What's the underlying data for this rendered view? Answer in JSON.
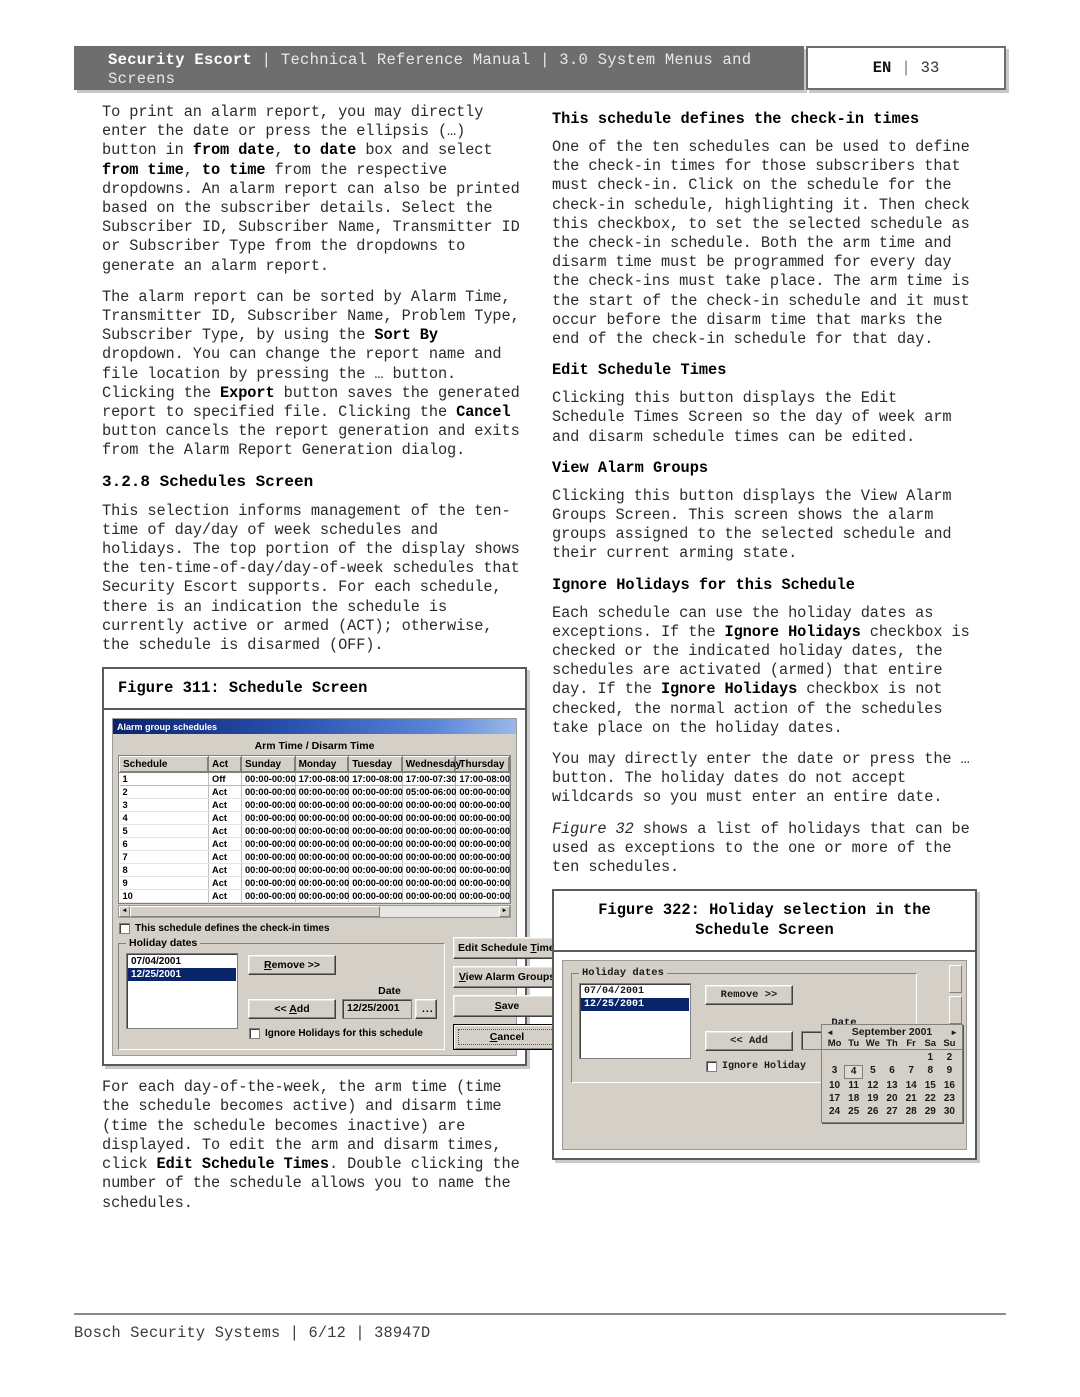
{
  "header": {
    "brand": "Security Escort",
    "sep": "|",
    "title_part1": "Technical Reference Manual",
    "title_part2": "3.0 System Menus and Screens",
    "full_title": "Security Escort | Technical Reference Manual | 3.0 System Menus and Screens",
    "language": "EN",
    "page_number": "33"
  },
  "left_column": {
    "p1_a": "To print an alarm report, you may directly enter the date or press the ellipsis (…) button in ",
    "p1_b1": "from date",
    "p1_c": ", ",
    "p1_b2": "to date",
    "p1_d": " box and select ",
    "p1_b3": "from time",
    "p1_e": ", ",
    "p1_b4": "to time",
    "p1_f": " from the respective dropdowns. An alarm report can also be printed based on the subscriber details. Select the Subscriber ID, Subscriber Name, Transmitter ID or Subscriber Type from the dropdowns to generate an alarm report.",
    "p2_a": "The alarm report can be sorted by Alarm Time, Transmitter ID, Subscriber Name, Problem Type, Subscriber Type, by using the ",
    "p2_b1": "Sort By",
    "p2_c": " dropdown. You can change the report name and file location by pressing the … button. Clicking the ",
    "p2_b2": "Export",
    "p2_d": " button saves the generated report to specified file. Clicking the ",
    "p2_b3": "Cancel",
    "p2_e": " button cancels the report generation and exits from the Alarm Report Generation dialog.",
    "section_heading": "3.2.8 Schedules Screen",
    "p3": "This selection informs management of the ten-time of day/day of week schedules and holidays. The top portion of the display shows the ten-time-of-day/day-of-week schedules that Security Escort supports. For each schedule, there is an indication the schedule is currently active or armed (ACT); otherwise, the schedule is disarmed (OFF).",
    "figure311_caption": "Figure 311: Schedule Screen",
    "p4_a": "For each day-of-the-week, the arm time (time the schedule becomes active) and disarm time (time the schedule becomes inactive) are displayed. To edit the arm and disarm times, click ",
    "p4_b1": "Edit Schedule Times",
    "p4_c": ". Double clicking the number of the schedule allows you to name the schedules."
  },
  "right_column": {
    "h1": "This schedule defines the check-in times",
    "p1": "One of the ten schedules can be used to define the check-in times for those subscribers that must check-in. Click on the schedule for the check-in schedule, highlighting it. Then check this checkbox, to set the selected schedule as the check-in schedule. Both the arm time and disarm time must be programmed for every day the check-ins must take place. The arm time is the start of the check-in schedule and it must occur before the disarm time that marks the end of the check-in schedule for that day.",
    "h2": "Edit Schedule Times",
    "p2": "Clicking this button displays the Edit Schedule Times Screen so the day of week arm and disarm schedule times can be edited.",
    "h3": "View Alarm Groups",
    "p3": "Clicking this button displays the View Alarm Groups Screen. This screen shows the alarm groups assigned to the selected schedule and their current arming state.",
    "h4": "Ignore Holidays for this Schedule",
    "p4_a": "Each schedule can use the holiday dates as exceptions. If the ",
    "p4_b1": "Ignore Holidays",
    "p4_c": " checkbox is checked or the indicated holiday dates, the schedules are activated (armed) that entire day. If the ",
    "p4_b2": "Ignore Holidays",
    "p4_d": " checkbox is not checked, the normal action of the schedules take place on the holiday dates.",
    "p5": "You may directly enter the date or press the … button. The holiday dates do not accept wildcards so you must enter an entire date.",
    "p6_i": "Figure 32",
    "p6_b": " shows a list of holidays that can be used as exceptions to the one or more of the ten schedules.",
    "figure322_caption_line1": "Figure 322: Holiday selection in the",
    "figure322_caption_line2": "Schedule Screen"
  },
  "figure311": {
    "window_title": "Alarm group schedules",
    "grid_title": "Arm Time / Disarm Time",
    "columns": [
      "Schedule",
      "Act",
      "Sunday",
      "Monday",
      "Tuesday",
      "Wednesday",
      "Thursday"
    ],
    "rows": [
      {
        "schedule": "1",
        "act": "Off",
        "sunday": "00:00-00:00",
        "monday": "17:00-08:00",
        "tuesday": "17:00-08:00",
        "wednesday": "17:00-07:30",
        "thursday": "17:00-08:00"
      },
      {
        "schedule": "2",
        "act": "Act",
        "sunday": "00:00-00:00",
        "monday": "00:00-00:00",
        "tuesday": "00:00-00:00",
        "wednesday": "05:00-06:00",
        "thursday": "00:00-00:00"
      },
      {
        "schedule": "3",
        "act": "Act",
        "sunday": "00:00-00:00",
        "monday": "00:00-00:00",
        "tuesday": "00:00-00:00",
        "wednesday": "00:00-00:00",
        "thursday": "00:00-00:00"
      },
      {
        "schedule": "4",
        "act": "Act",
        "sunday": "00:00-00:00",
        "monday": "00:00-00:00",
        "tuesday": "00:00-00:00",
        "wednesday": "00:00-00:00",
        "thursday": "00:00-00:00"
      },
      {
        "schedule": "5",
        "act": "Act",
        "sunday": "00:00-00:00",
        "monday": "00:00-00:00",
        "tuesday": "00:00-00:00",
        "wednesday": "00:00-00:00",
        "thursday": "00:00-00:00"
      },
      {
        "schedule": "6",
        "act": "Act",
        "sunday": "00:00-00:00",
        "monday": "00:00-00:00",
        "tuesday": "00:00-00:00",
        "wednesday": "00:00-00:00",
        "thursday": "00:00-00:00"
      },
      {
        "schedule": "7",
        "act": "Act",
        "sunday": "00:00-00:00",
        "monday": "00:00-00:00",
        "tuesday": "00:00-00:00",
        "wednesday": "00:00-00:00",
        "thursday": "00:00-00:00"
      },
      {
        "schedule": "8",
        "act": "Act",
        "sunday": "00:00-00:00",
        "monday": "00:00-00:00",
        "tuesday": "00:00-00:00",
        "wednesday": "00:00-00:00",
        "thursday": "00:00-00:00"
      },
      {
        "schedule": "9",
        "act": "Act",
        "sunday": "00:00-00:00",
        "monday": "00:00-00:00",
        "tuesday": "00:00-00:00",
        "wednesday": "00:00-00:00",
        "thursday": "00:00-00:00"
      },
      {
        "schedule": "10",
        "act": "Act",
        "sunday": "00:00-00:00",
        "monday": "00:00-00:00",
        "tuesday": "00:00-00:00",
        "wednesday": "00:00-00:00",
        "thursday": "00:00-00:00"
      }
    ],
    "checkin_checkbox_label": "This schedule defines the check-in times",
    "holiday_group_label": "Holiday dates",
    "holiday_dates": [
      "07/04/2001",
      "12/25/2001"
    ],
    "selected_holiday_index": 1,
    "remove_button": "Remove >>",
    "add_button": "<< Add",
    "date_label": "Date",
    "date_value": "12/25/2001",
    "dots_button": "...",
    "ignore_holidays_label": "Ignore Holidays for this schedule",
    "edit_schedule_times_button": "Edit Schedule Times",
    "view_alarm_groups_button": "View Alarm Groups",
    "save_button": "Save",
    "cancel_button": "Cancel",
    "scroll_left_arrow": "◄",
    "scroll_right_arrow": "►"
  },
  "figure322": {
    "holiday_group_label": "Holiday dates",
    "holiday_dates": [
      "07/04/2001",
      "12/25/2001"
    ],
    "selected_holiday_index": 1,
    "remove_button": "Remove >>",
    "add_button": "<< Add",
    "date_label": "Date",
    "date_value": "",
    "dots_button": "...",
    "ignore_holidays_label": "Ignore Holiday",
    "calendar": {
      "prev_arrow": "◄",
      "next_arrow": "►",
      "month_year": "September 2001",
      "day_headers": [
        "Mo",
        "Tu",
        "We",
        "Th",
        "Fr",
        "Sa",
        "Su"
      ],
      "leading_blanks": 5,
      "days": [
        1,
        2,
        3,
        4,
        5,
        6,
        7,
        8,
        9,
        10,
        11,
        12,
        13,
        14,
        15,
        16,
        17,
        18,
        19,
        20,
        21,
        22,
        23,
        24,
        25,
        26,
        27,
        28,
        29,
        30
      ],
      "selected_day": 4
    }
  },
  "footer": {
    "text": "Bosch Security Systems | 6/12 | 38947D"
  },
  "colors": {
    "header_band": "#6e6e6e",
    "win_face": "#d4d0c8",
    "title_blue": "#0a246a",
    "selection_blue": "#0a246a"
  }
}
